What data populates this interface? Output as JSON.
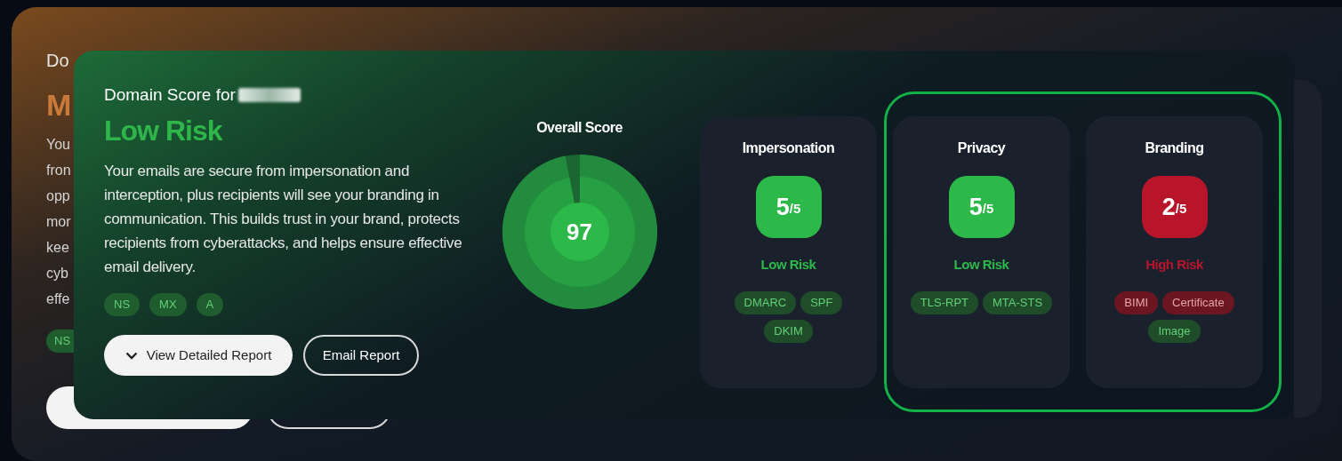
{
  "background_card": {
    "heading_fragment": "Do",
    "risk_fragment": "M",
    "description_fragments": [
      "You",
      "fron",
      "opp",
      "mor",
      "kee",
      "cyb",
      "effe"
    ],
    "tag_fragments": [
      "NS"
    ]
  },
  "report": {
    "title": "Domain Score for",
    "risk_label": "Low Risk",
    "color": "#2fb64a",
    "description": "Your emails are secure from impersonation and interception, plus recipients will see your branding in communication. This builds trust in your brand, protects recipients from cyberattacks, and helps ensure effective email delivery.",
    "tags": [
      "NS",
      "MX",
      "A"
    ],
    "buttons": [
      {
        "label": "View Detailed Report",
        "kind": "primary"
      },
      {
        "label": "Email Report",
        "kind": "outline"
      }
    ]
  },
  "overall_score": {
    "title": "Overall Score",
    "value": "97",
    "level": 0.97
  },
  "categories": [
    {
      "title": "Impersonation",
      "score": "5",
      "out_of": "/5",
      "risk_label": "Low Risk",
      "color": "#2db84a",
      "highlighted": false,
      "tags": [
        {
          "label": "DMARC",
          "color": "#1f4d2a"
        },
        {
          "label": "SPF",
          "color": "#1f4d2a"
        },
        {
          "label": "DKIM",
          "color": "#1f4d2a"
        }
      ]
    },
    {
      "title": "Privacy",
      "score": "5",
      "out_of": "/5",
      "risk_label": "Low Risk",
      "color": "#2db84a",
      "highlighted": true,
      "tags": [
        {
          "label": "TLS-RPT",
          "color": "#1f4d2a"
        },
        {
          "label": "MTA-STS",
          "color": "#1f4d2a"
        }
      ]
    },
    {
      "title": "Branding",
      "score": "2",
      "out_of": "/5",
      "risk_label": "High Risk",
      "color": "#b8152a",
      "highlighted": true,
      "tags": [
        {
          "label": "BIMI",
          "color": "#6b1620"
        },
        {
          "label": "Certificate",
          "color": "#6b1620"
        },
        {
          "label": "Image",
          "color": "#1f4d2a"
        }
      ]
    }
  ]
}
